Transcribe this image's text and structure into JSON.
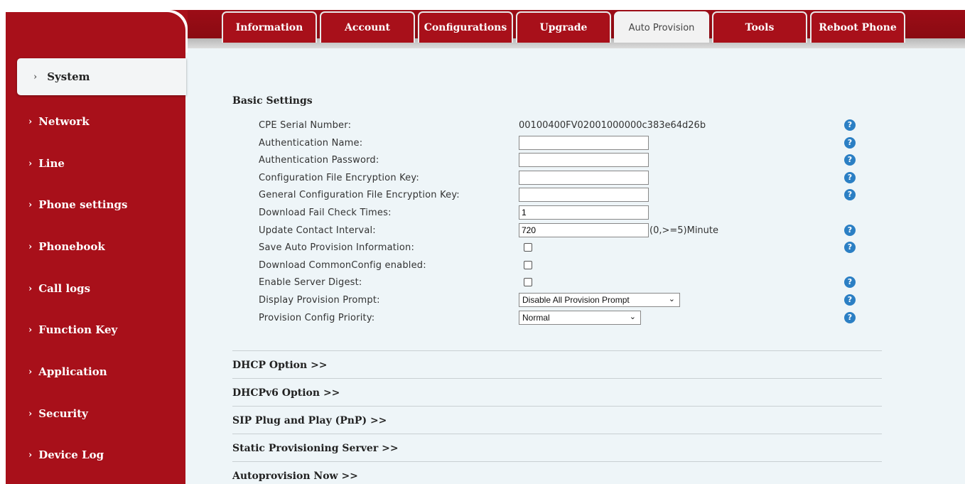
{
  "tabs": [
    "Information",
    "Account",
    "Configurations",
    "Upgrade",
    "Auto Provision",
    "Tools",
    "Reboot Phone"
  ],
  "active_tab": "Auto Provision",
  "sidebar": {
    "items": [
      {
        "label": "System"
      },
      {
        "label": "Network"
      },
      {
        "label": "Line"
      },
      {
        "label": "Phone settings"
      },
      {
        "label": "Phonebook"
      },
      {
        "label": "Call logs"
      },
      {
        "label": "Function Key"
      },
      {
        "label": "Application"
      },
      {
        "label": "Security"
      },
      {
        "label": "Device Log"
      }
    ],
    "active": "System",
    "chevron": "›"
  },
  "basic": {
    "title": "Basic Settings",
    "rows": [
      {
        "label": "CPE Serial Number:",
        "type": "text",
        "value": "00100400FV02001000000c383e64d26b",
        "help": true
      },
      {
        "label": "Authentication Name:",
        "type": "input",
        "value": "",
        "help": true
      },
      {
        "label": "Authentication Password:",
        "type": "input",
        "value": "",
        "help": true
      },
      {
        "label": "Configuration File Encryption Key:",
        "type": "input",
        "value": "",
        "help": true
      },
      {
        "label": "General Configuration File Encryption Key:",
        "type": "input",
        "value": "",
        "help": true
      },
      {
        "label": "Download Fail Check Times:",
        "type": "input",
        "value": "1",
        "help": false
      },
      {
        "label": "Update Contact Interval:",
        "type": "input",
        "value": "720",
        "unit": "(0,>=5)Minute",
        "help": true
      },
      {
        "label": "Save Auto Provision Information:",
        "type": "checkbox",
        "checked": false,
        "help": true
      },
      {
        "label": "Download CommonConfig enabled:",
        "type": "checkbox",
        "checked": false,
        "help": false
      },
      {
        "label": "Enable Server Digest:",
        "type": "checkbox",
        "checked": false,
        "help": true
      },
      {
        "label": "Display Provision Prompt:",
        "type": "select",
        "value": "Disable All Provision Prompt",
        "help": true
      },
      {
        "label": "Provision Config Priority:",
        "type": "select",
        "value": "Normal",
        "help": true
      }
    ]
  },
  "collapsibles": [
    "DHCP Option >>",
    "DHCPv6 Option >>",
    "SIP Plug and Play (PnP) >>",
    "Static Provisioning Server >>",
    "Autoprovision Now >>"
  ],
  "help_glyph": "?",
  "select_arrow": "⌄",
  "colors": {
    "brand": "#a8101a",
    "background": "#eef5f8",
    "help": "#2b7fc4"
  }
}
